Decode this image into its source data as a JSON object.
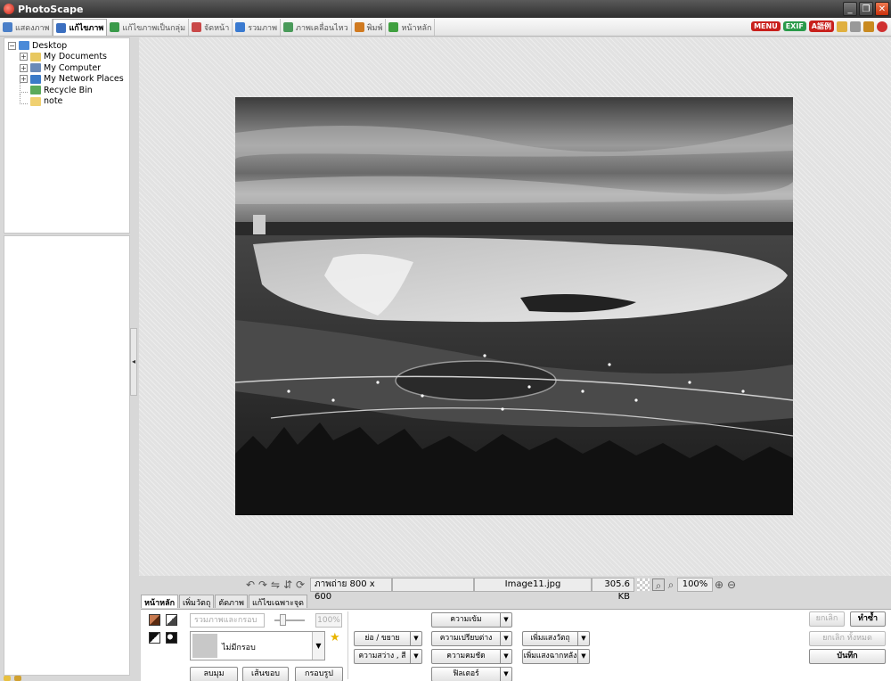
{
  "window": {
    "title": "PhotoScape"
  },
  "tabs": [
    {
      "label": "แสดงภาพ",
      "icon": "viewer-icon",
      "color": "#4a7fc8"
    },
    {
      "label": "แก้ไขภาพ",
      "icon": "editor-icon",
      "color": "#3b6fc0"
    },
    {
      "label": "แก้ไขภาพเป็นกลุ่ม",
      "icon": "batch-editor-icon",
      "color": "#3a9a4a"
    },
    {
      "label": "จัดหน้า",
      "icon": "page-icon",
      "color": "#c94848"
    },
    {
      "label": "รวมภาพ",
      "icon": "combine-icon",
      "color": "#3a7ad0"
    },
    {
      "label": "ภาพเคลื่อนไหว",
      "icon": "animated-gif-icon",
      "color": "#4a9a5a"
    },
    {
      "label": "พิมพ์",
      "icon": "print-icon",
      "color": "#d07a20"
    },
    {
      "label": "หน้าหลัก",
      "icon": "home-icon",
      "color": "#40a040"
    }
  ],
  "top_right": {
    "menu_label": "MENU",
    "exif_label": "EXIF",
    "lang_label": "A語例"
  },
  "tree": [
    {
      "label": "Desktop",
      "level": 0,
      "expander": "-",
      "icon": "desktop-icon"
    },
    {
      "label": "My Documents",
      "level": 1,
      "expander": "+",
      "icon": "folder-icon"
    },
    {
      "label": "My Computer",
      "level": 1,
      "expander": "+",
      "icon": "computer-icon"
    },
    {
      "label": "My Network Places",
      "level": 1,
      "expander": "+",
      "icon": "network-icon"
    },
    {
      "label": "Recycle Bin",
      "level": 1,
      "expander": "",
      "icon": "recycle-bin-icon"
    },
    {
      "label": "note",
      "level": 1,
      "expander": "",
      "icon": "folder-icon"
    }
  ],
  "status": {
    "photo_info": "ภาพถ่าย 800 x 600",
    "filename": "Image11.jpg",
    "filesize": "305.6 KB",
    "zoom": "100%"
  },
  "edit_tabs": [
    "หน้าหลัก",
    "เพิ่มวัตถุ",
    "ตัดภาพ",
    "แก้ไขเฉพาะจุด"
  ],
  "home": {
    "frame_placeholder": "รวมภาพและกรอบ",
    "frame_percent": "100%",
    "frame_selected": "ไม่มีกรอบ",
    "btn_round": "ลบมุม",
    "btn_border": "เส้นขอบ",
    "btn_frame": "กรอบรูป",
    "btn_resize": "ย่อ / ขยาย",
    "btn_brightness": "ความสว่าง , สี",
    "btn_auto_level": "ความเข้ม",
    "btn_backlight": "ความเปรียบต่าง",
    "btn_sharpen": "ความคมชัด",
    "btn_filter": "ฟิลเตอร์",
    "btn_add_object": "เพิ่มแสงวัตถุ",
    "btn_add_backlight": "เพิ่มแสงฉากหลัง"
  },
  "actions": {
    "undo": "ยกเลิก",
    "redo": "ทำซ้ำ",
    "undo_all": "ยกเลิก ทั้งหมด",
    "save": "บันทึก"
  }
}
